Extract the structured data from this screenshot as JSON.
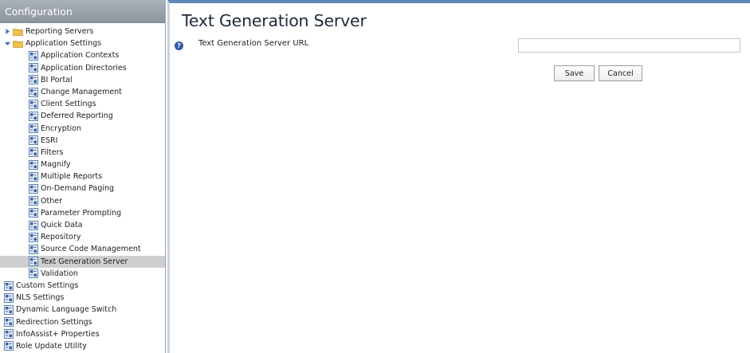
{
  "sidebar": {
    "title": "Configuration",
    "items": [
      {
        "label": "Reporting Servers",
        "level": 0,
        "type": "folder",
        "expanded": false
      },
      {
        "label": "Application Settings",
        "level": 0,
        "type": "folder",
        "expanded": true
      },
      {
        "label": "Application Contexts",
        "level": 1,
        "type": "node"
      },
      {
        "label": "Application Directories",
        "level": 1,
        "type": "node"
      },
      {
        "label": "BI Portal",
        "level": 1,
        "type": "node"
      },
      {
        "label": "Change Management",
        "level": 1,
        "type": "node"
      },
      {
        "label": "Client Settings",
        "level": 1,
        "type": "node"
      },
      {
        "label": "Deferred Reporting",
        "level": 1,
        "type": "node"
      },
      {
        "label": "Encryption",
        "level": 1,
        "type": "node"
      },
      {
        "label": "ESRI",
        "level": 1,
        "type": "node"
      },
      {
        "label": "Filters",
        "level": 1,
        "type": "node"
      },
      {
        "label": "Magnify",
        "level": 1,
        "type": "node"
      },
      {
        "label": "Multiple Reports",
        "level": 1,
        "type": "node"
      },
      {
        "label": "On-Demand Paging",
        "level": 1,
        "type": "node"
      },
      {
        "label": "Other",
        "level": 1,
        "type": "node"
      },
      {
        "label": "Parameter Prompting",
        "level": 1,
        "type": "node"
      },
      {
        "label": "Quick Data",
        "level": 1,
        "type": "node"
      },
      {
        "label": "Repository",
        "level": 1,
        "type": "node"
      },
      {
        "label": "Source Code Management",
        "level": 1,
        "type": "node"
      },
      {
        "label": "Text Generation Server",
        "level": 1,
        "type": "node",
        "selected": true
      },
      {
        "label": "Validation",
        "level": 1,
        "type": "node"
      },
      {
        "label": "Custom Settings",
        "level": 0,
        "type": "node"
      },
      {
        "label": "NLS Settings",
        "level": 0,
        "type": "node"
      },
      {
        "label": "Dynamic Language Switch",
        "level": 0,
        "type": "node"
      },
      {
        "label": "Redirection Settings",
        "level": 0,
        "type": "node"
      },
      {
        "label": "InfoAssist+ Properties",
        "level": 0,
        "type": "node"
      },
      {
        "label": "Role Update Utility",
        "level": 0,
        "type": "node"
      }
    ]
  },
  "main": {
    "title": "Text Generation Server",
    "fields": [
      {
        "label": "Text Generation Server URL",
        "value": "",
        "placeholder": ""
      }
    ],
    "buttons": {
      "save": "Save",
      "cancel": "Cancel"
    }
  },
  "colors": {
    "sidebar_header_top": "#a9b1ba",
    "sidebar_header_bottom": "#8c959f",
    "selected_row": "#cfcfcf",
    "main_top_border": "#5f86b8",
    "folder": "#f2c24f",
    "help_icon": "#2e5fb0"
  },
  "icons": {
    "folder": "folder-icon",
    "node": "config-node-icon",
    "expand": "triangle-right-icon",
    "collapse": "triangle-down-icon",
    "help": "help-icon"
  }
}
